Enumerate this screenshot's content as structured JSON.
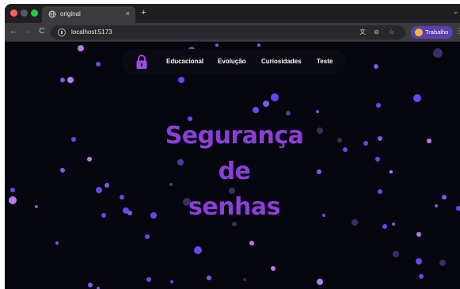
{
  "browser": {
    "tab": {
      "title": "original",
      "close_glyph": "×"
    },
    "new_tab_glyph": "+",
    "tab_search_glyph": "⌄",
    "nav": {
      "back_glyph": "←",
      "forward_glyph": "→",
      "reload_glyph": "C"
    },
    "omnibox": {
      "url": "localhost:5173",
      "translate_glyph": "文",
      "zoom_glyph": "⊖",
      "star_glyph": "☆"
    },
    "profile": {
      "name": "Trabalho"
    },
    "menu_glyph": "⋮"
  },
  "page": {
    "navbar": {
      "logo_icon": "padlock-icon",
      "items": [
        "Educacional",
        "Evolução",
        "Curiosidades",
        "Teste"
      ]
    },
    "hero": {
      "lines": [
        "Segurança",
        "de",
        "senhas"
      ]
    }
  },
  "colors": {
    "background": "#05050d",
    "accent": "#8b3fd9",
    "particle_palette": [
      "#6b4bff",
      "#8b5cf6",
      "#c77dff",
      "#4a3fae",
      "#5b4a9c"
    ]
  }
}
